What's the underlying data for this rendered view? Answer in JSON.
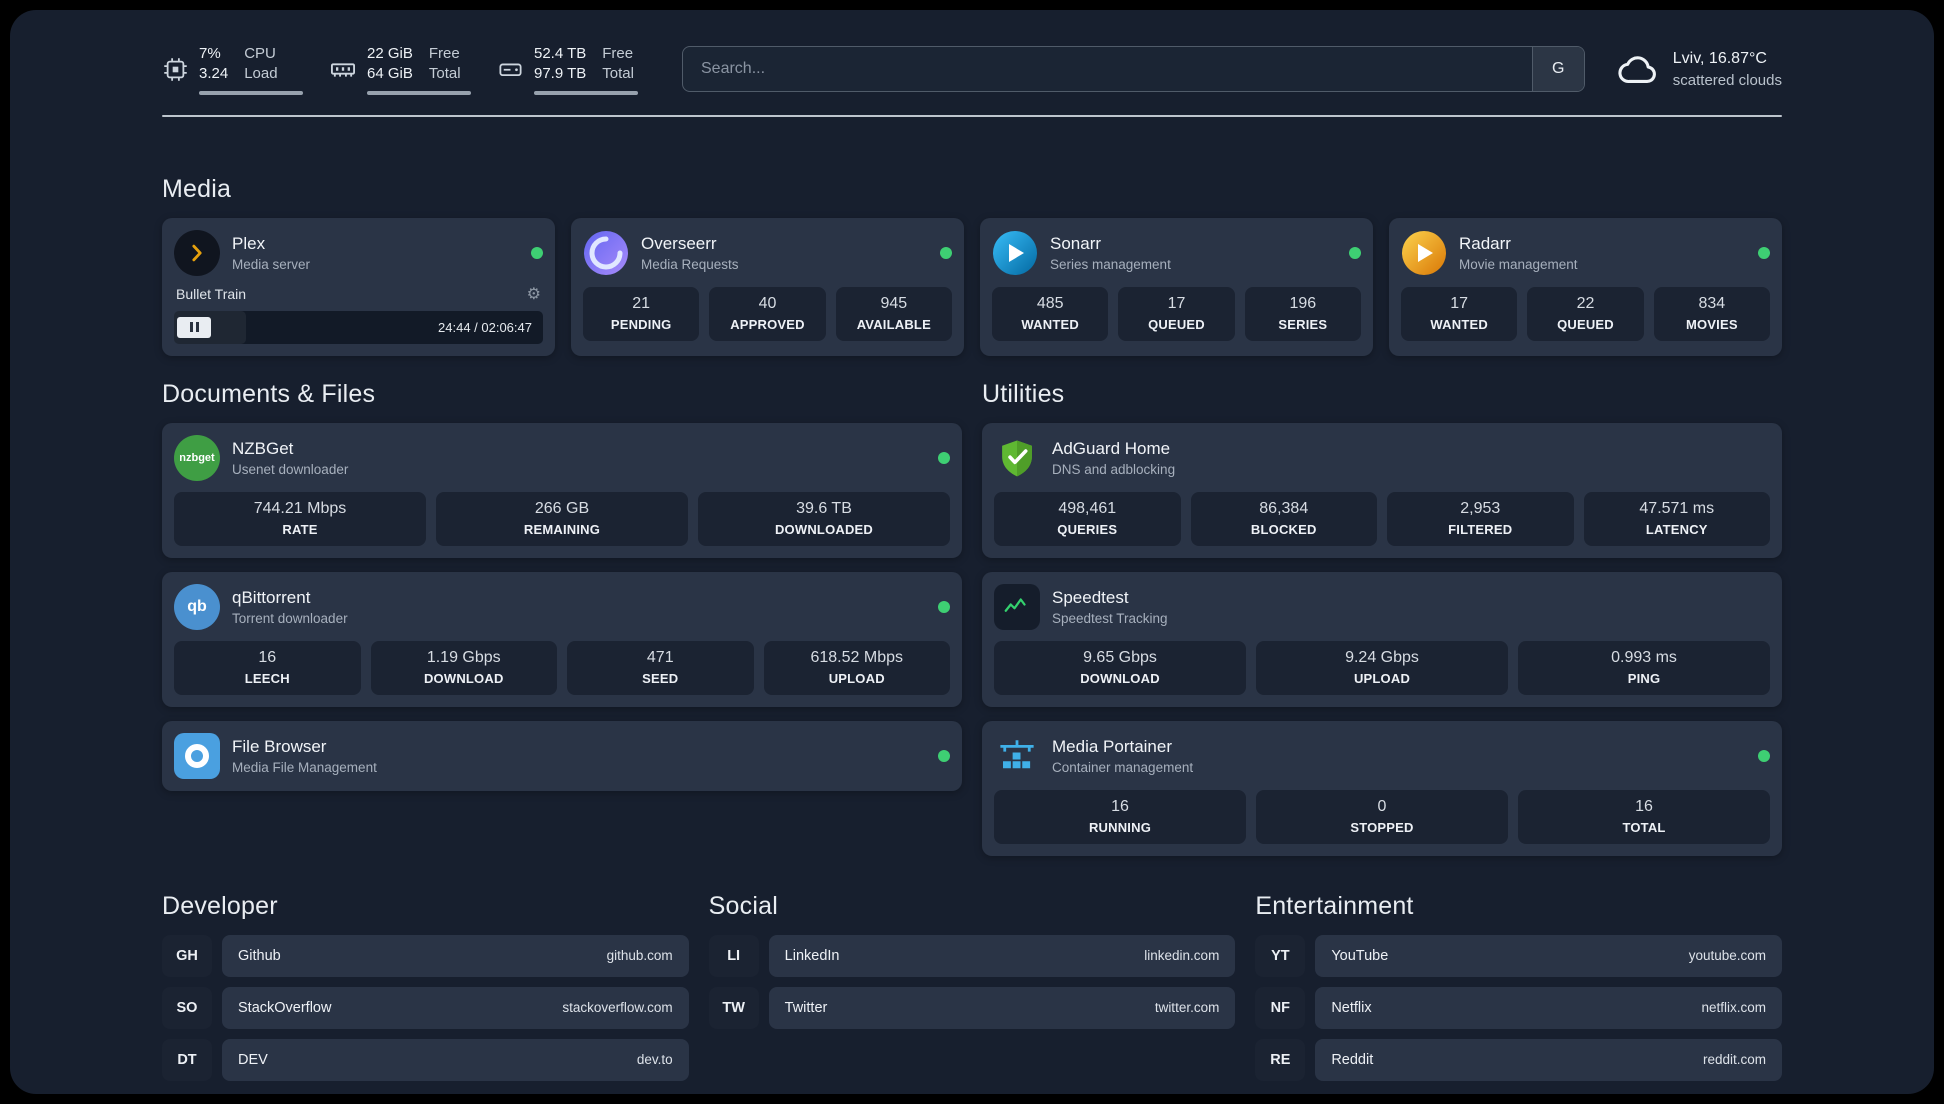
{
  "topbar": {
    "cpu": {
      "value": "7%",
      "sub": "3.24",
      "label1": "CPU",
      "label2": "Load"
    },
    "memory": {
      "value": "22 GiB",
      "sub": "64 GiB",
      "label1": "Free",
      "label2": "Total"
    },
    "disk": {
      "value": "52.4 TB",
      "sub": "97.9 TB",
      "label1": "Free",
      "label2": "Total"
    },
    "search": {
      "placeholder": "Search...",
      "button_label": "G"
    },
    "weather": {
      "location": "Lviv, 16.87°C",
      "condition": "scattered clouds"
    }
  },
  "sections": {
    "media": {
      "title": "Media"
    },
    "documents": {
      "title": "Documents & Files"
    },
    "utilities": {
      "title": "Utilities"
    },
    "developer": {
      "title": "Developer"
    },
    "social": {
      "title": "Social"
    },
    "entertainment": {
      "title": "Entertainment"
    }
  },
  "apps": {
    "plex": {
      "name": "Plex",
      "subtitle": "Media server",
      "now_playing": "Bullet Train",
      "time": "24:44 / 02:06:47"
    },
    "overseerr": {
      "name": "Overseerr",
      "subtitle": "Media Requests",
      "stats": [
        {
          "value": "21",
          "label": "PENDING"
        },
        {
          "value": "40",
          "label": "APPROVED"
        },
        {
          "value": "945",
          "label": "AVAILABLE"
        }
      ]
    },
    "sonarr": {
      "name": "Sonarr",
      "subtitle": "Series management",
      "stats": [
        {
          "value": "485",
          "label": "WANTED"
        },
        {
          "value": "17",
          "label": "QUEUED"
        },
        {
          "value": "196",
          "label": "SERIES"
        }
      ]
    },
    "radarr": {
      "name": "Radarr",
      "subtitle": "Movie management",
      "stats": [
        {
          "value": "17",
          "label": "WANTED"
        },
        {
          "value": "22",
          "label": "QUEUED"
        },
        {
          "value": "834",
          "label": "MOVIES"
        }
      ]
    },
    "nzbget": {
      "name": "NZBGet",
      "subtitle": "Usenet downloader",
      "stats": [
        {
          "value": "744.21 Mbps",
          "label": "RATE"
        },
        {
          "value": "266 GB",
          "label": "REMAINING"
        },
        {
          "value": "39.6 TB",
          "label": "DOWNLOADED"
        }
      ]
    },
    "qbittorrent": {
      "name": "qBittorrent",
      "subtitle": "Torrent downloader",
      "stats": [
        {
          "value": "16",
          "label": "LEECH"
        },
        {
          "value": "1.19 Gbps",
          "label": "DOWNLOAD"
        },
        {
          "value": "471",
          "label": "SEED"
        },
        {
          "value": "618.52 Mbps",
          "label": "UPLOAD"
        }
      ]
    },
    "filebrowser": {
      "name": "File Browser",
      "subtitle": "Media File Management"
    },
    "adguard": {
      "name": "AdGuard Home",
      "subtitle": "DNS and adblocking",
      "stats": [
        {
          "value": "498,461",
          "label": "QUERIES"
        },
        {
          "value": "86,384",
          "label": "BLOCKED"
        },
        {
          "value": "2,953",
          "label": "FILTERED"
        },
        {
          "value": "47.571 ms",
          "label": "LATENCY"
        }
      ]
    },
    "speedtest": {
      "name": "Speedtest",
      "subtitle": "Speedtest Tracking",
      "stats": [
        {
          "value": "9.65 Gbps",
          "label": "DOWNLOAD"
        },
        {
          "value": "9.24 Gbps",
          "label": "UPLOAD"
        },
        {
          "value": "0.993 ms",
          "label": "PING"
        }
      ]
    },
    "portainer": {
      "name": "Media Portainer",
      "subtitle": "Container management",
      "stats": [
        {
          "value": "16",
          "label": "RUNNING"
        },
        {
          "value": "0",
          "label": "STOPPED"
        },
        {
          "value": "16",
          "label": "TOTAL"
        }
      ]
    }
  },
  "bookmarks": {
    "developer": [
      {
        "abbr": "GH",
        "name": "Github",
        "url": "github.com"
      },
      {
        "abbr": "SO",
        "name": "StackOverflow",
        "url": "stackoverflow.com"
      },
      {
        "abbr": "DT",
        "name": "DEV",
        "url": "dev.to"
      }
    ],
    "social": [
      {
        "abbr": "LI",
        "name": "LinkedIn",
        "url": "linkedin.com"
      },
      {
        "abbr": "TW",
        "name": "Twitter",
        "url": "twitter.com"
      }
    ],
    "entertainment": [
      {
        "abbr": "YT",
        "name": "YouTube",
        "url": "youtube.com"
      },
      {
        "abbr": "NF",
        "name": "Netflix",
        "url": "netflix.com"
      },
      {
        "abbr": "RE",
        "name": "Reddit",
        "url": "reddit.com"
      }
    ]
  },
  "icons": {
    "gear_glyph": "⚙",
    "nzbget_glyph": "nzbget",
    "qbittorrent_glyph": "qb"
  },
  "colors": {
    "status_online": "#3ecf73",
    "plex_accent": "#e5a00d",
    "background": "#171f2e",
    "card": "#2a3446",
    "tile": "#1b2332"
  }
}
